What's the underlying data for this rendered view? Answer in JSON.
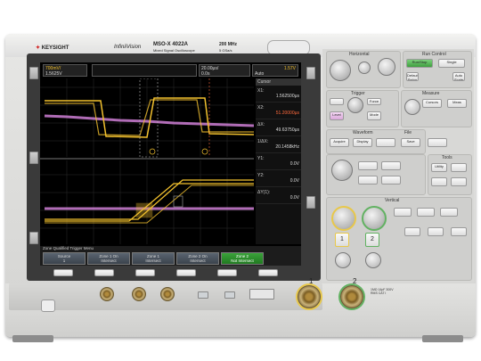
{
  "header": {
    "brand": "KEYSIGHT",
    "product_line": "InfiniiVision",
    "model": "MSO-X 4022A",
    "model_sub": "Mixed Signal Oscilloscope",
    "bandwidth": "200 MHz",
    "sample_rate": "5 GSa/s"
  },
  "screen": {
    "ch1_scale": "700mV/",
    "ch1_offset": "1.5625V",
    "timebase_scale": "20.00μs/",
    "timebase_delay": "0.0s",
    "trigger_mode": "Auto",
    "trigger_level": "1.57V",
    "cursor_label": "Cursor",
    "meas_rows": [
      {
        "label": "X1:",
        "value": "1.562500μs",
        "color": "#dddddd"
      },
      {
        "label": "X2:",
        "value": "51.20000μs",
        "color": "#ff6a3d"
      },
      {
        "label": "ΔX:",
        "value": "49.63750μs",
        "color": "#dddddd"
      },
      {
        "label": "1/ΔX:",
        "value": "20.1458kHz",
        "color": "#dddddd"
      },
      {
        "label": "Y1:",
        "value": "0.0V",
        "color": "#dddddd"
      },
      {
        "label": "Y2:",
        "value": "0.0V",
        "color": "#dddddd"
      },
      {
        "label": "ΔY(1):",
        "value": "0.0V",
        "color": "#dddddd"
      }
    ],
    "menu_title": "Zone Qualified Trigger Menu",
    "softkeys": [
      {
        "top": "Source",
        "bottom": "1"
      },
      {
        "top": "Zone 1 On",
        "bottom": "Intersect"
      },
      {
        "top": "Zone 1",
        "bottom": "Intersect"
      },
      {
        "top": "Zone 2 On",
        "bottom": "Intersect"
      },
      {
        "top": "Zone 2",
        "bottom": "Not Intersect"
      }
    ],
    "ch1_color": "#f2c12e",
    "ch2_color": "#cf7fd6"
  },
  "panel": {
    "horizontal": "Horizontal",
    "run_control": "Run Control",
    "run_stop": "Run/Stop",
    "single": "Single",
    "trigger": "Trigger",
    "measure": "Measure",
    "waveform": "Waveform",
    "file": "File",
    "tools": "Tools",
    "vertical": "Vertical",
    "btn_force": "Force",
    "btn_level": "Level",
    "btn_mode": "Mode",
    "btn_cursors": "Cursors",
    "btn_meas": "Meas",
    "btn_acquire": "Acquire",
    "btn_display": "Display",
    "btn_save": "Save",
    "btn_utility": "Utility",
    "btn_default": "Default Setup",
    "btn_auto": "Auto Scale",
    "ch_labels": [
      "1",
      "2"
    ]
  },
  "front": {
    "ch1_label": "1",
    "ch2_label": "2",
    "input_spec": "1MΩ 14pF 300V RMS CAT I"
  }
}
